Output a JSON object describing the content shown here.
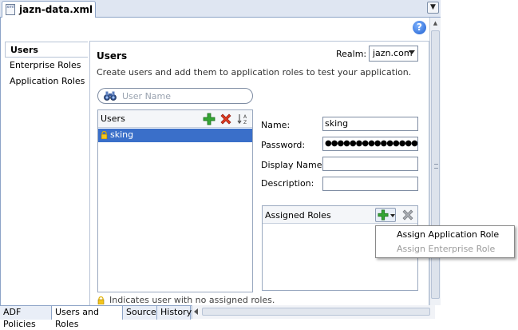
{
  "file_tab": {
    "label": "jazn-data.xml",
    "icon": "xml-file-icon",
    "icon_text": "xml"
  },
  "help_label": "?",
  "nav": {
    "items": [
      {
        "label": "Users",
        "selected": true
      },
      {
        "label": "Enterprise Roles",
        "selected": false
      },
      {
        "label": "Application Roles",
        "selected": false
      }
    ]
  },
  "users_section": {
    "title": "Users",
    "description": "Create users and add them to application roles to test your application.",
    "realm_label": "Realm:",
    "realm_value": "jazn.com",
    "search_placeholder": "User Name",
    "list_header": "Users",
    "users": [
      {
        "name": "sking",
        "selected": true,
        "no_roles": true
      }
    ],
    "legend": "Indicates user with no assigned roles."
  },
  "form": {
    "name_label": "Name:",
    "name_value": "sking",
    "password_label": "Password:",
    "password_value": "●●●●●●●●●●●●●●●●●●●●●●●",
    "display_label": "Display Name:",
    "display_value": "",
    "description_label": "Description:",
    "description_value": ""
  },
  "assigned_roles": {
    "title": "Assigned Roles",
    "menu": [
      {
        "label": "Assign Application Role",
        "enabled": true
      },
      {
        "label": "Assign Enterprise Role",
        "enabled": false
      }
    ]
  },
  "bottom_tabs": [
    {
      "label": "ADF Policies",
      "active": false
    },
    {
      "label": "Users and Roles",
      "active": true
    },
    {
      "label": "Source",
      "active": false
    },
    {
      "label": "History",
      "active": false
    }
  ],
  "colors": {
    "selection": "#3a6fc9",
    "add_green": "#2f9e2f",
    "delete_red": "#d8311f",
    "disabled_text": "#9b9b9b"
  }
}
